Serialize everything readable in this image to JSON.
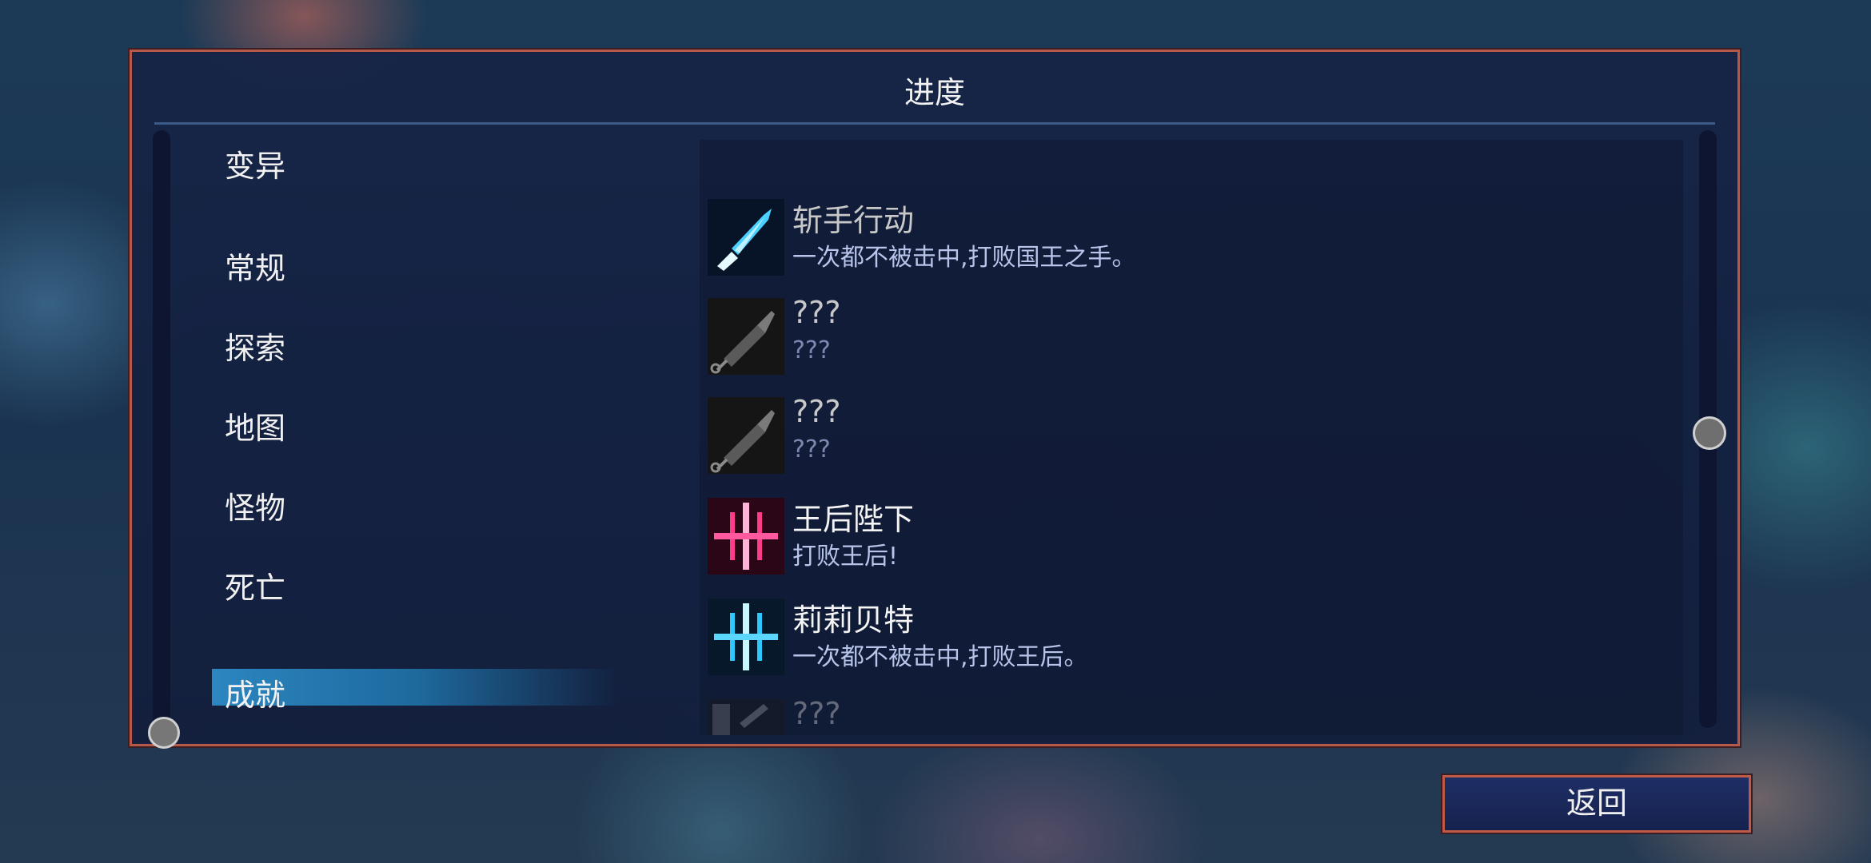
{
  "panel": {
    "title": "进度"
  },
  "categories": [
    {
      "label": "变异"
    },
    {
      "label": "常规"
    },
    {
      "label": "探索"
    },
    {
      "label": "地图"
    },
    {
      "label": "怪物"
    },
    {
      "label": "死亡"
    },
    {
      "label": "成就",
      "selected": true
    }
  ],
  "achievements": [
    {
      "title": "斩手行动",
      "desc": "一次都不被击中,打败国王之手。",
      "icon": "dagger-icon",
      "state": "unlocked"
    },
    {
      "title": "???",
      "desc": "???",
      "icon": "syringe-icon",
      "state": "locked"
    },
    {
      "title": "???",
      "desc": "???",
      "icon": "syringe-icon",
      "state": "locked"
    },
    {
      "title": "王后陛下",
      "desc": "打败王后!",
      "icon": "pink-sword-icon",
      "state": "unlocked"
    },
    {
      "title": "莉莉贝特",
      "desc": "一次都不被击中,打败王后。",
      "icon": "cyan-sword-icon",
      "state": "unlocked"
    },
    {
      "title": "???",
      "desc": "???",
      "icon": "locked-tower-icon",
      "state": "locked"
    }
  ],
  "footer": {
    "back_label": "返回"
  }
}
